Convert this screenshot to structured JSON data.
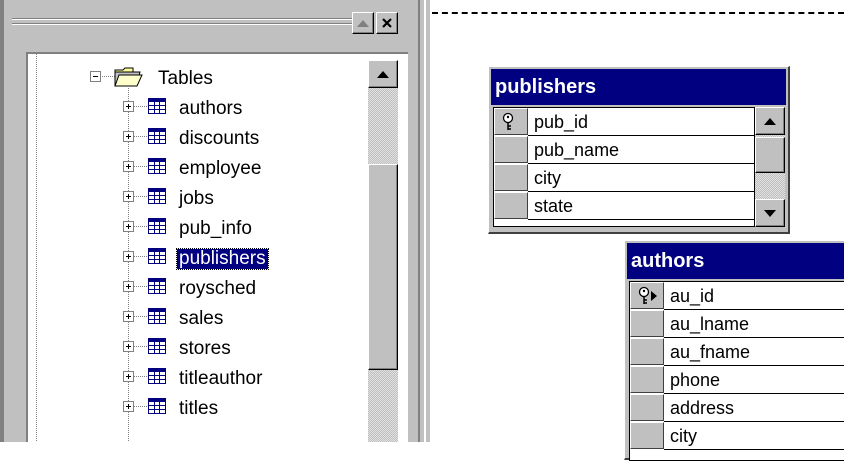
{
  "tree": {
    "folder_label": "Tables",
    "items": [
      {
        "label": "authors",
        "selected": false
      },
      {
        "label": "discounts",
        "selected": false
      },
      {
        "label": "employee",
        "selected": false
      },
      {
        "label": "jobs",
        "selected": false
      },
      {
        "label": "pub_info",
        "selected": false
      },
      {
        "label": "publishers",
        "selected": true
      },
      {
        "label": "roysched",
        "selected": false
      },
      {
        "label": "sales",
        "selected": false
      },
      {
        "label": "stores",
        "selected": false
      },
      {
        "label": "titleauthor",
        "selected": false
      },
      {
        "label": "titles",
        "selected": false
      }
    ]
  },
  "diagram": {
    "publishers": {
      "title": "publishers",
      "columns": [
        "pub_id",
        "pub_name",
        "city",
        "state"
      ]
    },
    "authors": {
      "title": "authors",
      "columns": [
        "au_id",
        "au_lname",
        "au_fname",
        "phone",
        "address",
        "city"
      ]
    }
  },
  "colors": {
    "title_bar": "#000080",
    "face": "#c0c0c0",
    "selection": "#000080"
  },
  "icons": {
    "table": "table-icon",
    "folder": "folder-icon",
    "key": "primary-key-icon"
  }
}
